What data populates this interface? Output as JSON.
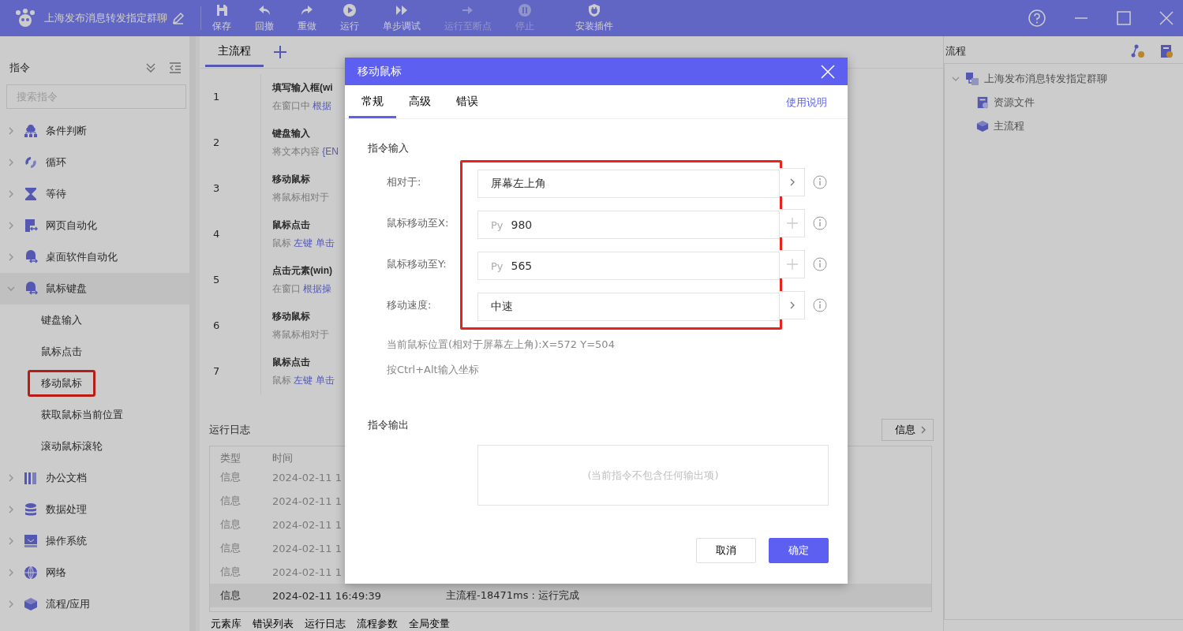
{
  "app": {
    "title": "上海发布消息转发指定群聊"
  },
  "toolbar": [
    {
      "label": "保存",
      "kind": "save",
      "disabled": false
    },
    {
      "label": "回撤",
      "kind": "undo",
      "disabled": false
    },
    {
      "label": "重做",
      "kind": "redo",
      "disabled": false
    },
    {
      "label": "运行",
      "kind": "run",
      "disabled": false
    },
    {
      "label": "单步调试",
      "kind": "step",
      "disabled": false
    },
    {
      "label": "运行至断点",
      "kind": "breakpoint",
      "disabled": true
    },
    {
      "label": "停止",
      "kind": "stop",
      "disabled": true
    },
    {
      "label": "安装插件",
      "kind": "plugin",
      "disabled": false
    }
  ],
  "sidebar": {
    "title": "指令",
    "search_placeholder": "搜索指令",
    "categories": [
      {
        "label": "条件判断",
        "kind": "branch",
        "expanded": false
      },
      {
        "label": "循环",
        "kind": "loop",
        "expanded": false
      },
      {
        "label": "等待",
        "kind": "hourglass",
        "expanded": false
      },
      {
        "label": "网页自动化",
        "kind": "web",
        "expanded": false
      },
      {
        "label": "桌面软件自动化",
        "kind": "app",
        "expanded": false
      },
      {
        "label": "鼠标键盘",
        "kind": "app",
        "expanded": true,
        "children": [
          {
            "label": "键盘输入",
            "highlighted": false
          },
          {
            "label": "鼠标点击",
            "highlighted": false
          },
          {
            "label": "移动鼠标",
            "highlighted": true
          },
          {
            "label": "获取鼠标当前位置",
            "highlighted": false
          },
          {
            "label": "滚动鼠标滚轮",
            "highlighted": false
          }
        ]
      },
      {
        "label": "办公文档",
        "kind": "books",
        "expanded": false
      },
      {
        "label": "数据处理",
        "kind": "database",
        "expanded": false
      },
      {
        "label": "操作系统",
        "kind": "monitor",
        "expanded": false
      },
      {
        "label": "网络",
        "kind": "globe",
        "expanded": false
      },
      {
        "label": "流程/应用",
        "kind": "cube",
        "expanded": false
      }
    ]
  },
  "editor": {
    "tabs": [
      {
        "label": "主流程",
        "selected": true
      }
    ],
    "steps": [
      {
        "number": "1",
        "title": "填写输入框(wi",
        "description": [
          {
            "kind": "plain",
            "text": "在窗口中"
          },
          {
            "kind": "param",
            "text": "根据"
          }
        ]
      },
      {
        "number": "2",
        "title": "键盘输入",
        "description": [
          {
            "kind": "plain",
            "text": "将文本内容"
          },
          {
            "kind": "param",
            "text": "{EN"
          }
        ]
      },
      {
        "number": "3",
        "title": "移动鼠标",
        "description": [
          {
            "kind": "plain",
            "text": "将鼠标相对于"
          }
        ]
      },
      {
        "number": "4",
        "title": "鼠标点击",
        "description": [
          {
            "kind": "plain",
            "text": "鼠标"
          },
          {
            "kind": "param",
            "text": "左键"
          },
          {
            "kind": "param",
            "text": "单击"
          }
        ]
      },
      {
        "number": "5",
        "title": "点击元素(win)",
        "description": [
          {
            "kind": "plain",
            "text": "在窗口"
          },
          {
            "kind": "param",
            "text": "根据操"
          }
        ]
      },
      {
        "number": "6",
        "title": "移动鼠标",
        "description": [
          {
            "kind": "plain",
            "text": "将鼠标相对于"
          }
        ]
      },
      {
        "number": "7",
        "title": "鼠标点击",
        "description": [
          {
            "kind": "plain",
            "text": "鼠标"
          },
          {
            "kind": "param",
            "text": "左键"
          },
          {
            "kind": "param",
            "text": "单击"
          }
        ]
      }
    ]
  },
  "log": {
    "title": "运行日志",
    "filter": "信息",
    "columns": [
      "类型",
      "时间"
    ],
    "rows": [
      {
        "type": "信息",
        "time": "2024-02-11 1",
        "selected": false
      },
      {
        "type": "信息",
        "time": "2024-02-11 1",
        "selected": false
      },
      {
        "type": "信息",
        "time": "2024-02-11 1",
        "selected": false
      },
      {
        "type": "信息",
        "time": "2024-02-11 1",
        "selected": false
      },
      {
        "type": "信息",
        "time": "2024-02-11 1",
        "selected": false
      },
      {
        "type": "信息",
        "time": "2024-02-11 16:49:39",
        "message": "主流程-18471ms : 运行完成",
        "selected": true
      }
    ]
  },
  "bottom_tabs": [
    "元素库",
    "错误列表",
    "运行日志",
    "流程参数",
    "全局变量"
  ],
  "flow_panel": {
    "title": "流程",
    "tree": [
      {
        "label": "上海发布消息转发指定群聊",
        "kind": "project",
        "expanded": true,
        "children": [
          {
            "label": "资源文件",
            "kind": "resource"
          },
          {
            "label": "主流程",
            "kind": "cube"
          }
        ]
      }
    ]
  },
  "dialog": {
    "title": "移动鼠标",
    "tabs": [
      {
        "label": "常规",
        "selected": true
      },
      {
        "label": "高级",
        "selected": false
      },
      {
        "label": "错误",
        "selected": false
      }
    ],
    "help_link": "使用说明",
    "input_section": "指令输入",
    "highlighted": true,
    "fields": [
      {
        "label": "相对于:",
        "kind": "select",
        "value": "屏幕左上角"
      },
      {
        "label": "鼠标移动至X:",
        "kind": "number",
        "prefix": "Py",
        "value": "980"
      },
      {
        "label": "鼠标移动至Y:",
        "kind": "number",
        "prefix": "Py",
        "value": "565"
      },
      {
        "label": "移动速度:",
        "kind": "select",
        "value": "中速"
      }
    ],
    "hints": [
      "当前鼠标位置(相对于屏幕左上角):X=572 Y=504",
      "按Ctrl+Alt输入坐标"
    ],
    "output_section": "指令输出",
    "output_placeholder": "(当前指令不包含任何输出项)",
    "buttons": [
      {
        "label": "取消",
        "kind": "secondary"
      },
      {
        "label": "确定",
        "kind": "primary"
      }
    ]
  }
}
